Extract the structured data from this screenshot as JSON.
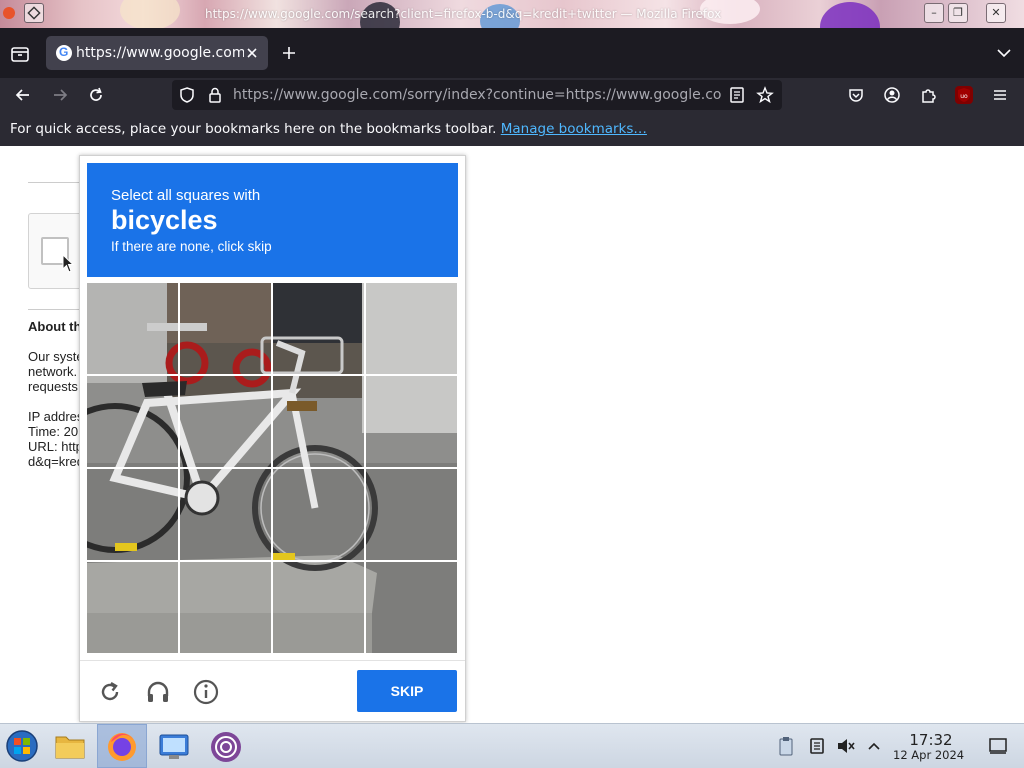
{
  "window": {
    "title": "https://www.google.com/search?client=firefox-b-d&q=kredit+twitter — Mozilla Firefox"
  },
  "tab": {
    "title": "https://www.google.com/",
    "favicon": "google-g-icon"
  },
  "urlbar": {
    "url": "https://www.google.com/sorry/index?continue=https://www.google.co"
  },
  "bookmarks_bar": {
    "message": "For quick access, place your bookmarks here on the bookmarks toolbar.",
    "link": "Manage bookmarks…"
  },
  "background_page": {
    "heading": "About th",
    "line1": "Our syste",
    "line2": "network.",
    "line3": "requests",
    "ip": "IP addres",
    "time": "Time: 20",
    "url": "URL: http",
    "query": "d&q=kred"
  },
  "captcha": {
    "instruction": "Select all squares with",
    "target": "bicycles",
    "hint": "If there are none, click skip",
    "skip_label": "SKIP",
    "colors": {
      "header": "#1a73e8",
      "button": "#1a73e8"
    }
  },
  "taskbar": {
    "time": "17:32",
    "date": "12 Apr 2024"
  }
}
